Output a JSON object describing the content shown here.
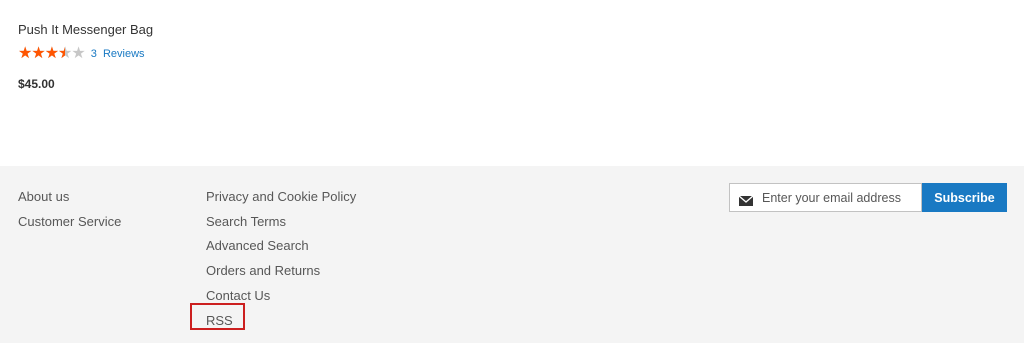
{
  "colors": {
    "link": "#1979c3",
    "star_filled": "#ff5501",
    "star_empty": "#c7c7c7",
    "footer_bg": "#f4f4f4",
    "button_bg": "#1979c3",
    "highlight": "#cc1f1f"
  },
  "product": {
    "name": "Push It Messenger Bag",
    "rating_fraction": 0.7,
    "stars_glyphs": "★★★★★",
    "review_count": "3",
    "reviews_label": "Reviews",
    "price": "$45.00"
  },
  "footer": {
    "column1": [
      "About us",
      "Customer Service"
    ],
    "column2": [
      "Privacy and Cookie Policy",
      "Search Terms",
      "Advanced Search",
      "Orders and Returns",
      "Contact Us",
      "RSS"
    ]
  },
  "newsletter": {
    "icon": "envelope-icon",
    "placeholder": "Enter your email address",
    "button_label": "Subscribe"
  }
}
